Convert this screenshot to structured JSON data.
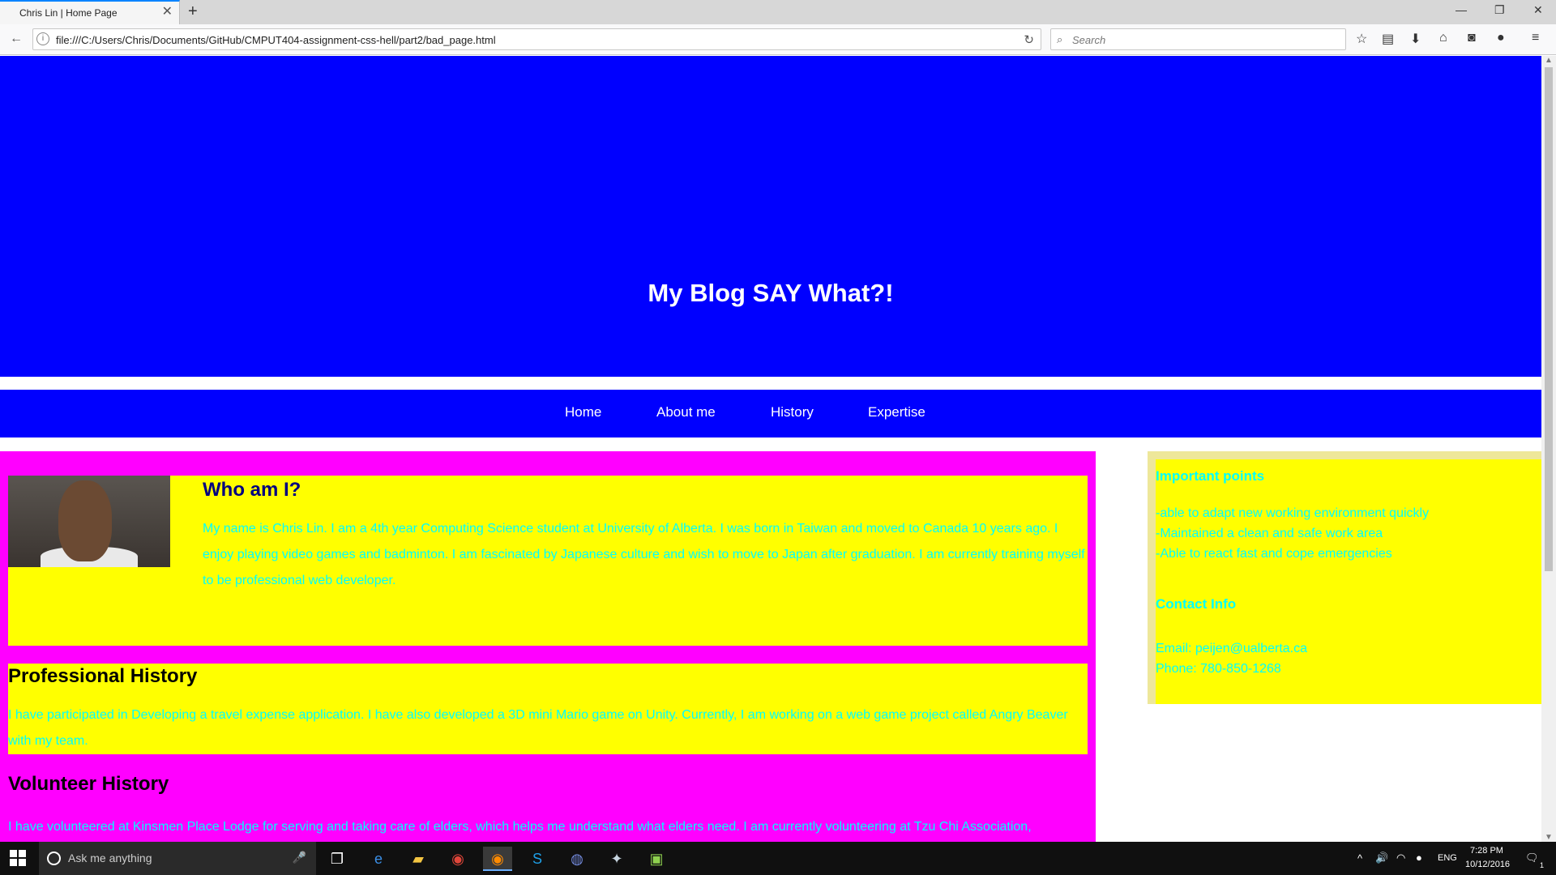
{
  "browser": {
    "tab_title": "Chris Lin | Home Page",
    "tab_close": "✕",
    "new_tab": "+",
    "url": "file:///C:/Users/Chris/Documents/GitHub/CMPUT404-assignment-css-hell/part2/bad_page.html",
    "search_placeholder": "Search",
    "window_controls": [
      "—",
      "❐",
      "✕"
    ]
  },
  "page": {
    "site_title": "My Blog SAY What?!",
    "nav": [
      "Home",
      "About me",
      "History",
      "Expertise"
    ],
    "who": {
      "title": "Who am I?",
      "text": "My name is Chris Lin. I am a 4th year Computing Science student at University of Alberta. I was born in Taiwan and moved to Canada 10 years ago. I enjoy playing video games and badminton. I am fascinated by Japanese culture and wish to move to Japan after graduation. I am currently training myself to be professional web developer."
    },
    "professional": {
      "title": "Professional History",
      "text": "I have participated in Developing a travel expense application. I have also developed a 3D mini Mario game on Unity. Currently, I am working on a web game project called Angry Beaver with my team."
    },
    "volunteer": {
      "title": "Volunteer History",
      "text": "I have volunteered at Kinsmen Place Lodge for serving and taking care of elders, which helps me understand what elders need. I am currently volunteering at Tzu Chi Association,"
    },
    "aside": {
      "points_title": "Important points",
      "points": [
        "-able to adapt new working environment quickly",
        "-Maintained a clean and safe work area",
        "-Able to react fast and cope emergencies"
      ],
      "contact_title": "Contact Info",
      "email": "Email: peijen@ualberta.ca",
      "phone": "Phone: 780-850-1268"
    }
  },
  "taskbar": {
    "search_placeholder": "Ask me anything",
    "lang": "ENG",
    "time": "7:28 PM",
    "date": "10/12/2016",
    "notification_count": "1"
  },
  "colors": {
    "header": "#0000ff",
    "main": "#ff00ff",
    "box": "#ffff00",
    "text": "#00ffff",
    "who_title": "#000080"
  }
}
